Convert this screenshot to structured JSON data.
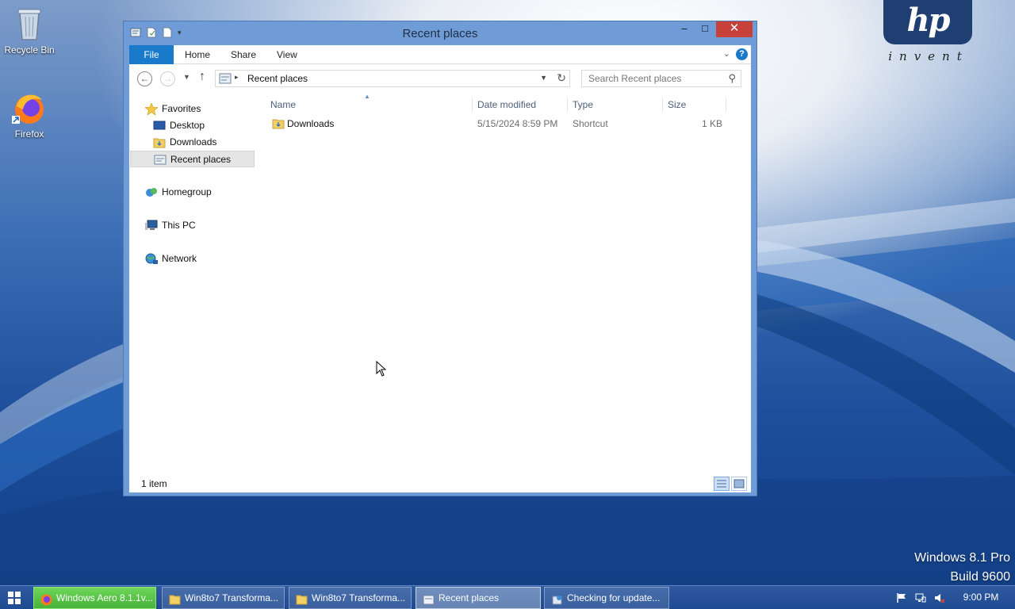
{
  "desktop": {
    "icons": [
      {
        "label": "Recycle Bin",
        "icon": "recycle-bin-icon"
      },
      {
        "label": "Firefox",
        "icon": "firefox-icon"
      }
    ],
    "hp_logo": {
      "brand": "hp",
      "tagline": "invent"
    },
    "watermark": {
      "line1": "Windows 8.1 Pro",
      "line2": "Build 9600"
    }
  },
  "window": {
    "title": "Recent places",
    "controls": {
      "minimize": "–",
      "maximize": "□",
      "close": "✕"
    },
    "ribbon": {
      "tabs": [
        "File",
        "Home",
        "Share",
        "View"
      ],
      "help": "?"
    },
    "address": {
      "crumb": "Recent places",
      "search_placeholder": "Search Recent places"
    },
    "nav_pane": {
      "favorites": {
        "label": "Favorites",
        "items": [
          "Desktop",
          "Downloads",
          "Recent places"
        ],
        "selected": "Recent places"
      },
      "homegroup": "Homegroup",
      "this_pc": "This PC",
      "network": "Network"
    },
    "columns": [
      "Name",
      "Date modified",
      "Type",
      "Size"
    ],
    "files": [
      {
        "name": "Downloads",
        "date_modified": "5/15/2024 8:59 PM",
        "type": "Shortcut",
        "size": "1 KB"
      }
    ],
    "status": "1 item"
  },
  "taskbar": {
    "buttons": [
      {
        "label": "Windows Aero 8.1.1v...",
        "icon": "firefox-icon",
        "state": "highlighted"
      },
      {
        "label": "Win8to7 Transforma...",
        "icon": "folder-icon",
        "state": "normal"
      },
      {
        "label": "Win8to7 Transforma...",
        "icon": "folder-icon",
        "state": "normal"
      },
      {
        "label": "Recent places",
        "icon": "recent-places-icon",
        "state": "active"
      },
      {
        "label": "Checking for update...",
        "icon": "installer-icon",
        "state": "normal"
      }
    ],
    "tray_icons": [
      "action-center-flag-icon",
      "network-icon",
      "volume-muted-icon"
    ],
    "clock": "9:00 PM"
  },
  "colors": {
    "accent": "#1979ca",
    "window_frame": "#6f9bd6",
    "close_button": "#c7403a",
    "taskbar": "#1e4a91"
  }
}
